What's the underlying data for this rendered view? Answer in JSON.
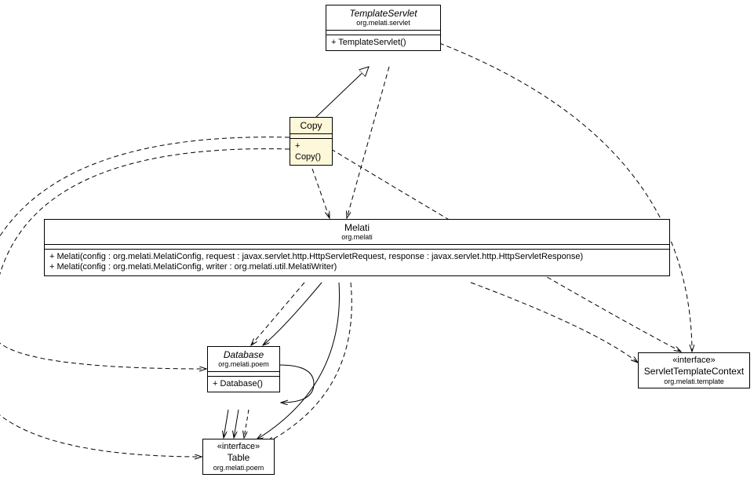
{
  "classes": {
    "templateServlet": {
      "name": "TemplateServlet",
      "pkg": "org.melati.servlet",
      "ops": [
        "+ TemplateServlet()"
      ],
      "abstract": true
    },
    "copy": {
      "name": "Copy",
      "ops": [
        "+ Copy()"
      ]
    },
    "melati": {
      "name": "Melati",
      "pkg": "org.melati",
      "ops": [
        "+ Melati(config : org.melati.MelatiConfig, request : javax.servlet.http.HttpServletRequest, response : javax.servlet.http.HttpServletResponse)",
        "+ Melati(config : org.melati.MelatiConfig, writer : org.melati.util.MelatiWriter)"
      ]
    },
    "database": {
      "name": "Database",
      "pkg": "org.melati.poem",
      "ops": [
        "+ Database()"
      ],
      "abstract": true
    },
    "table": {
      "stereotype": "«interface»",
      "name": "Table",
      "pkg": "org.melati.poem"
    },
    "servletTemplateContext": {
      "stereotype": "«interface»",
      "name": "ServletTemplateContext",
      "pkg": "org.melati.template"
    }
  }
}
